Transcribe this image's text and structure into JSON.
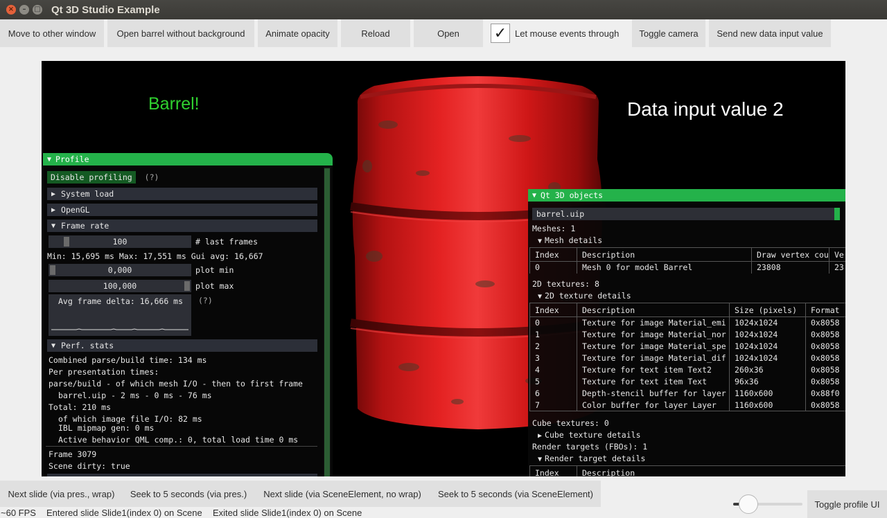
{
  "window": {
    "title": "Qt 3D Studio Example"
  },
  "toolbar": {
    "move_window": "Move to other window",
    "open_barrel": "Open barrel without background",
    "animate_opacity": "Animate opacity",
    "reload": "Reload",
    "open": "Open",
    "mouse_through_label": "Let mouse events through",
    "mouse_through_checked": true,
    "toggle_camera": "Toggle camera",
    "send_data_input": "Send new data input value"
  },
  "scene": {
    "barrel_text": "Barrel!",
    "data_input_text": "Data input value 2",
    "barrel_color": "#d41c1c",
    "text_color_green": "#2fd02f"
  },
  "profile": {
    "title": "Profile",
    "disable_profiling": "Disable profiling",
    "help": "(?)",
    "system_load": "System load",
    "opengl": "OpenGL",
    "frame_rate": "Frame rate",
    "last_frames_value": "100",
    "last_frames_label": "# last frames",
    "min_max_avg": "Min: 15,695 ms Max: 17,551 ms Gui avg: 16,667",
    "plot_min_value": "0,000",
    "plot_min_label": "plot min",
    "plot_max_value": "100,000",
    "plot_max_label": "plot max",
    "avg_frame_delta": "Avg frame delta: 16,666 ms",
    "help2": "(?)",
    "perf_stats": "Perf. stats",
    "combined_parse": "Combined parse/build time: 134 ms",
    "per_presentation": "Per presentation times:",
    "parse_build_header": "parse/build - of which mesh I/O - then to first frame",
    "barrel_times": "barrel.uip - 2 ms - 0 ms - 76 ms",
    "total": "Total: 210 ms",
    "image_io": "of which image file I/O: 82 ms",
    "ibl_gen": "IBL mipmap gen: 0 ms",
    "active_behavior": "Active behavior QML comp.: 0, total load time 0 ms",
    "frame": "Frame 3079",
    "scene_dirty": "Scene dirty: true"
  },
  "objects": {
    "title": "Qt 3D objects",
    "combo_value": "barrel.uip",
    "meshes": "Meshes: 1",
    "mesh_details": "Mesh details",
    "mesh_cols": [
      "Index",
      "Description",
      "Draw vertex cou",
      "Ve"
    ],
    "mesh_rows": [
      [
        "0",
        "Mesh 0 for model Barrel",
        "23808",
        "23"
      ]
    ],
    "tex2d": "2D textures: 8",
    "tex2d_details": "2D texture details",
    "tex_cols": [
      "Index",
      "Description",
      "Size (pixels)",
      "Format"
    ],
    "tex_rows": [
      [
        "0",
        "Texture for image Material_emi",
        "1024x1024",
        "0x8058"
      ],
      [
        "1",
        "Texture for image Material_nor",
        "1024x1024",
        "0x8058"
      ],
      [
        "2",
        "Texture for image Material_spe",
        "1024x1024",
        "0x8058"
      ],
      [
        "3",
        "Texture for image Material_dif",
        "1024x1024",
        "0x8058"
      ],
      [
        "4",
        "Texture for text item Text2",
        "260x36",
        "0x8058"
      ],
      [
        "5",
        "Texture for text item Text",
        "96x36",
        "0x8058"
      ],
      [
        "6",
        "Depth-stencil buffer for layer",
        "1160x600",
        "0x88f0"
      ],
      [
        "7",
        "Color buffer for layer Layer",
        "1160x600",
        "0x8058"
      ]
    ],
    "cube_textures": "Cube textures: 0",
    "cube_details": "Cube texture details",
    "render_targets": "Render targets (FBOs): 1",
    "render_target_details": "Render target details",
    "rt_cols": [
      "Index",
      "Description"
    ]
  },
  "bottombar": {
    "next_slide_pres": "Next slide (via pres., wrap)",
    "seek_pres": "Seek to 5 seconds (via pres.)",
    "next_slide_elem": "Next slide (via SceneElement, no wrap)",
    "seek_elem": "Seek to 5 seconds (via SceneElement)",
    "toggle_profile": "Toggle profile UI",
    "slider_value": 0.22
  },
  "status": {
    "fps": "~60 FPS",
    "entered": "Entered slide Slide1(index 0) on Scene",
    "exited": "Exited slide Slide1(index 0) on Scene"
  }
}
